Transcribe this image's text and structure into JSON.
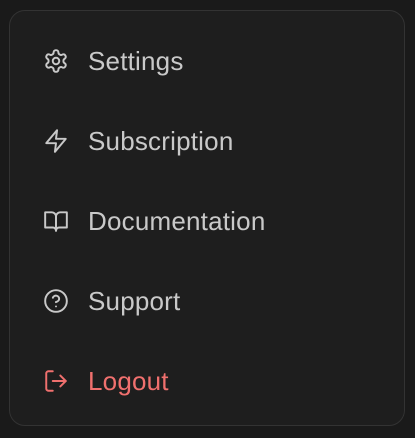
{
  "menu": {
    "items": [
      {
        "label": "Settings",
        "icon": "gear-icon"
      },
      {
        "label": "Subscription",
        "icon": "lightning-icon"
      },
      {
        "label": "Documentation",
        "icon": "book-icon"
      },
      {
        "label": "Support",
        "icon": "help-circle-icon"
      },
      {
        "label": "Logout",
        "icon": "logout-icon"
      }
    ]
  },
  "colors": {
    "background": "#1e1e1e",
    "border": "#333333",
    "text": "#c9c9c9",
    "danger": "#f0706e"
  }
}
